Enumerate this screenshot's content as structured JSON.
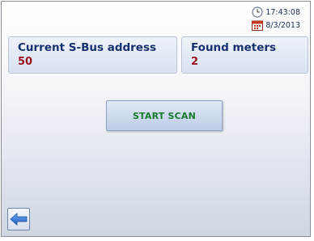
{
  "status": {
    "time": "17:43:08",
    "date": "8/3/2013",
    "icons": [
      "clock-icon",
      "calendar-icon"
    ]
  },
  "panels": {
    "address": {
      "title": "Current S-Bus address",
      "value": "50"
    },
    "meters": {
      "title": "Found meters",
      "value": "2"
    }
  },
  "actions": {
    "scan_label": "START SCAN",
    "back_icon": "left-arrow-icon"
  },
  "colors": {
    "title_text": "#17306e",
    "value_text": "#9b1522",
    "scan_text": "#19792d",
    "panel_bg": "#d9e2f1"
  }
}
